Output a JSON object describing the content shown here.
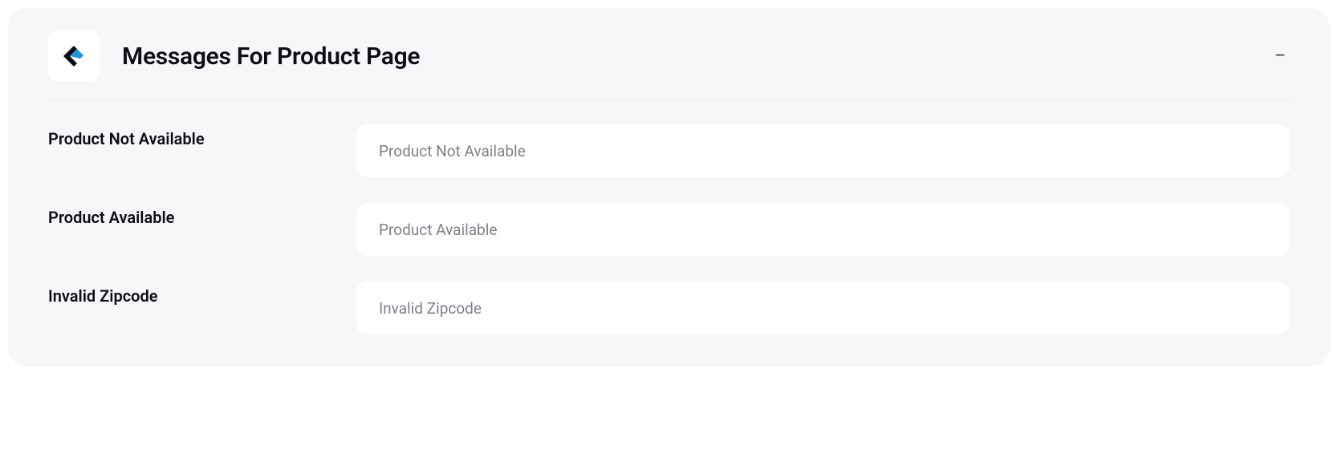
{
  "panel": {
    "title": "Messages For Product Page"
  },
  "fields": {
    "productNotAvailable": {
      "label": "Product Not Available",
      "placeholder": "Product Not Available",
      "value": ""
    },
    "productAvailable": {
      "label": "Product Available",
      "placeholder": "Product Available",
      "value": ""
    },
    "invalidZipcode": {
      "label": "Invalid Zipcode",
      "placeholder": "Invalid Zipcode",
      "value": ""
    }
  }
}
